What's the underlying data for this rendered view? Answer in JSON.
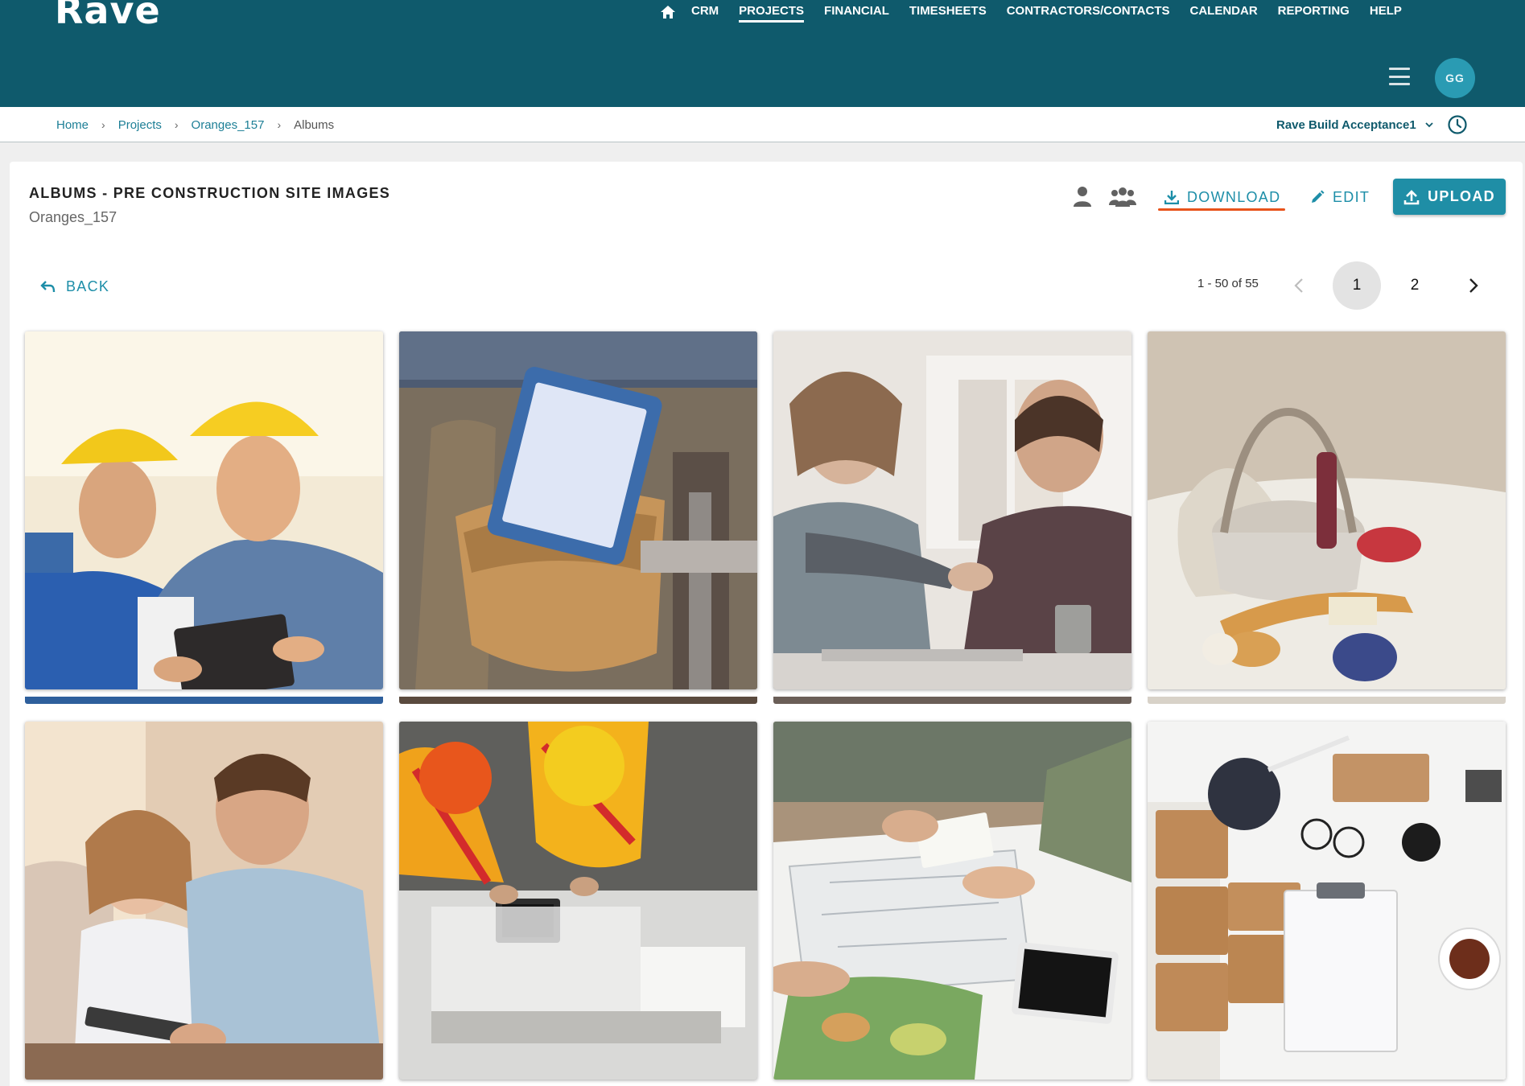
{
  "app": {
    "logo": "Rave",
    "nav": [
      "CRM",
      "PROJECTS",
      "FINANCIAL",
      "TIMESHEETS",
      "CONTRACTORS/CONTACTS",
      "CALENDAR",
      "REPORTING",
      "HELP"
    ],
    "active_nav": "PROJECTS",
    "avatar_initials": "GG",
    "brand_color": "#0f5a6c",
    "accent_color": "#1f8ea6"
  },
  "breadcrumb": {
    "items": [
      "Home",
      "Projects",
      "Oranges_157"
    ],
    "current": "Albums",
    "separator": "›"
  },
  "company": {
    "name": "Rave Build Acceptance1"
  },
  "album": {
    "title": "ALBUMS - PRE CONSTRUCTION SITE IMAGES",
    "project": "Oranges_157"
  },
  "toolbar": {
    "download_label": "DOWNLOAD",
    "edit_label": "EDIT",
    "upload_label": "UPLOAD"
  },
  "back_label": "BACK",
  "pagination": {
    "range": "1 - 50 of 55",
    "pages": [
      "1",
      "2"
    ],
    "current_page": "1"
  },
  "photos": [
    {
      "subject": "two workers in hard hats with tablet"
    },
    {
      "subject": "tool belt with tablet in pocket"
    },
    {
      "subject": "business handshake at table"
    },
    {
      "subject": "picnic basket on beach"
    },
    {
      "subject": "father and daughter with tablet"
    },
    {
      "subject": "workers in safety vests overhead"
    },
    {
      "subject": "team reviewing blueprints"
    },
    {
      "subject": "desk flat lay with lamp and clipboard"
    }
  ]
}
